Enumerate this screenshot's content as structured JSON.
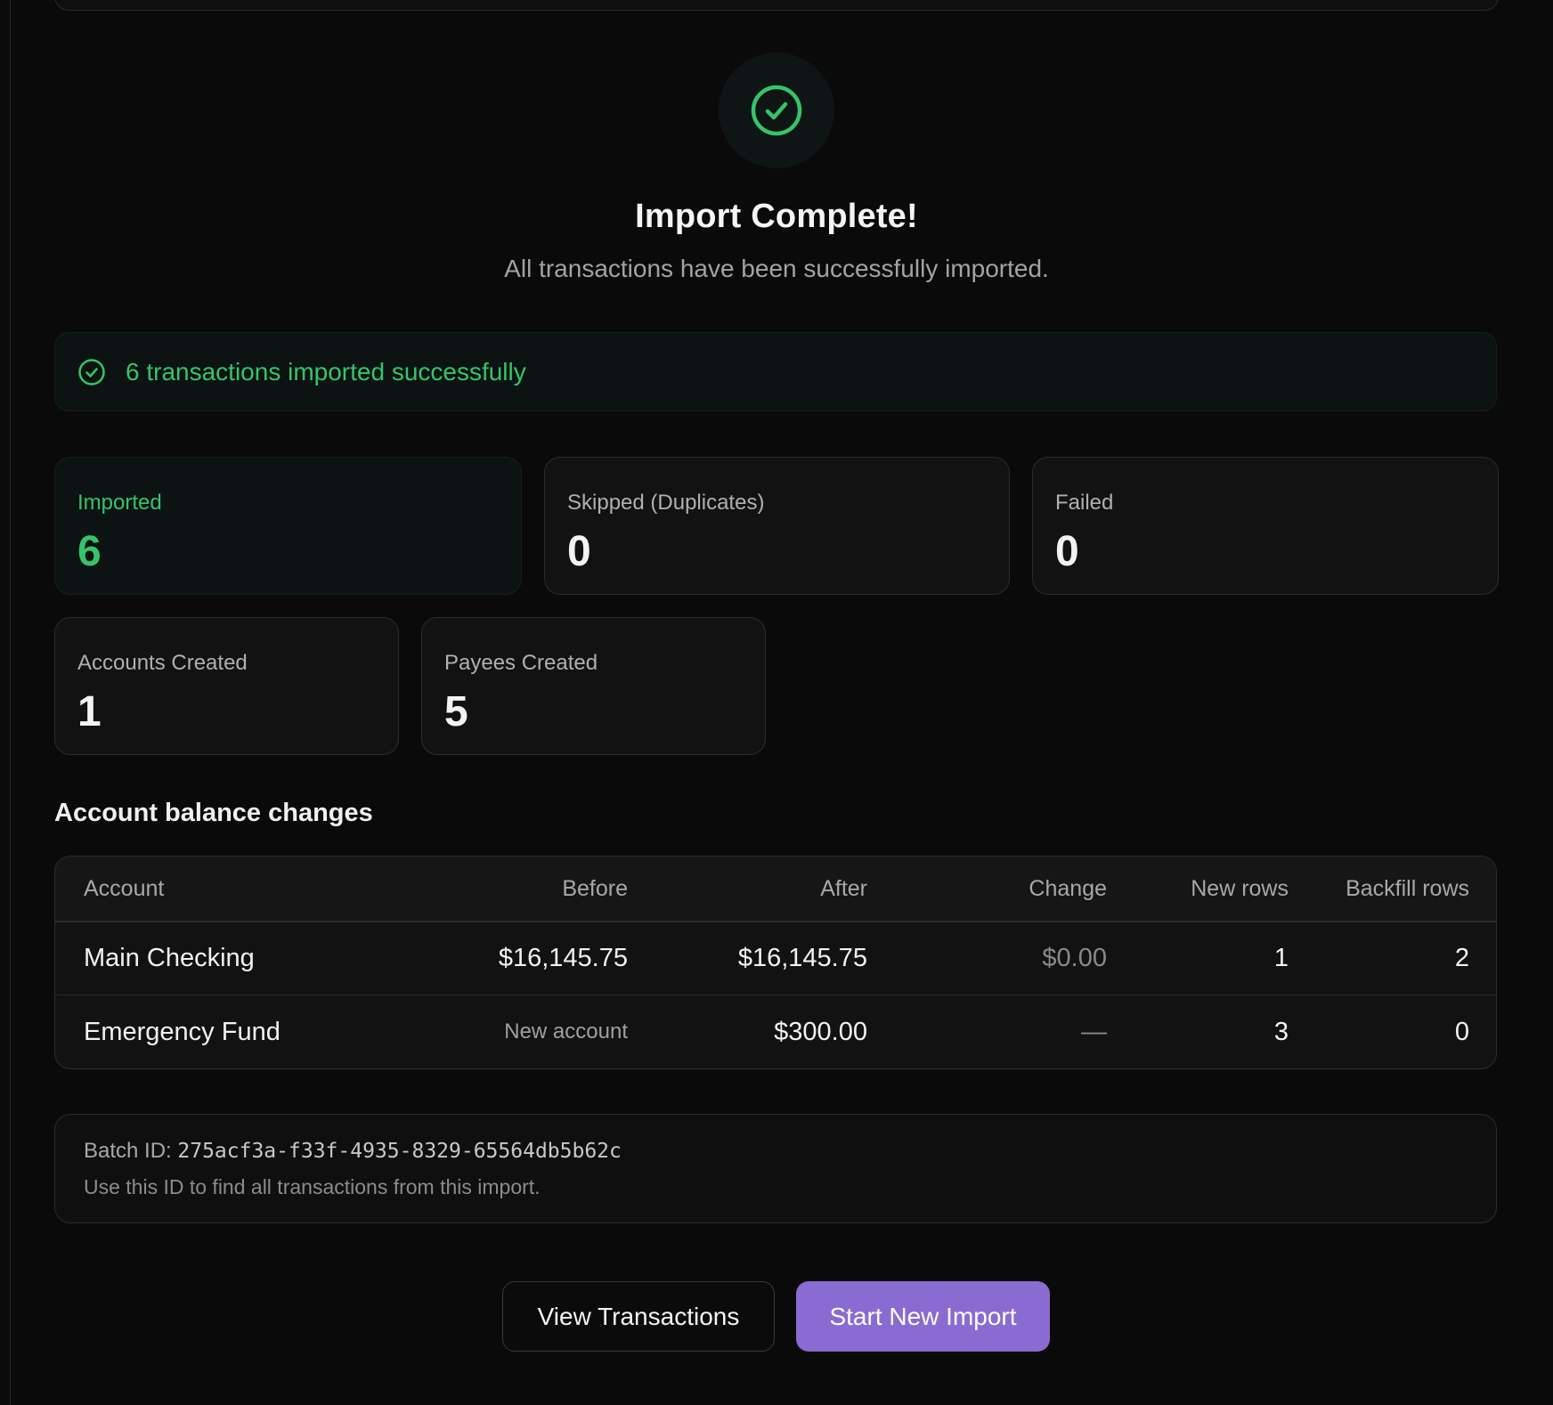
{
  "header": {
    "title": "Import Complete!",
    "subtitle": "All transactions have been successfully imported."
  },
  "banner": {
    "icon": "check-circle-icon",
    "text": "6 transactions imported successfully"
  },
  "stats": {
    "imported": {
      "label": "Imported",
      "value": "6"
    },
    "skipped": {
      "label": "Skipped (Duplicates)",
      "value": "0"
    },
    "failed": {
      "label": "Failed",
      "value": "0"
    },
    "accounts_created": {
      "label": "Accounts Created",
      "value": "1"
    },
    "payees_created": {
      "label": "Payees Created",
      "value": "5"
    }
  },
  "balances": {
    "title": "Account balance changes",
    "columns": [
      "Account",
      "Before",
      "After",
      "Change",
      "New rows",
      "Backfill rows"
    ],
    "rows": [
      {
        "account": "Main Checking",
        "before": "$16,145.75",
        "after": "$16,145.75",
        "change": "$0.00",
        "new_rows": "1",
        "backfill_rows": "2"
      },
      {
        "account": "Emergency Fund",
        "before": "New account",
        "after": "$300.00",
        "change": "—",
        "new_rows": "3",
        "backfill_rows": "0"
      }
    ]
  },
  "batch": {
    "label": "Batch ID: ",
    "id": "275acf3a-f33f-4935-8329-65564db5b62c",
    "hint": "Use this ID to find all transactions from this import."
  },
  "actions": {
    "view_transactions": "View Transactions",
    "start_new_import": "Start New Import"
  },
  "colors": {
    "success": "#35c46a",
    "primary": "#8a6bd1",
    "background": "#0a0a0a"
  }
}
